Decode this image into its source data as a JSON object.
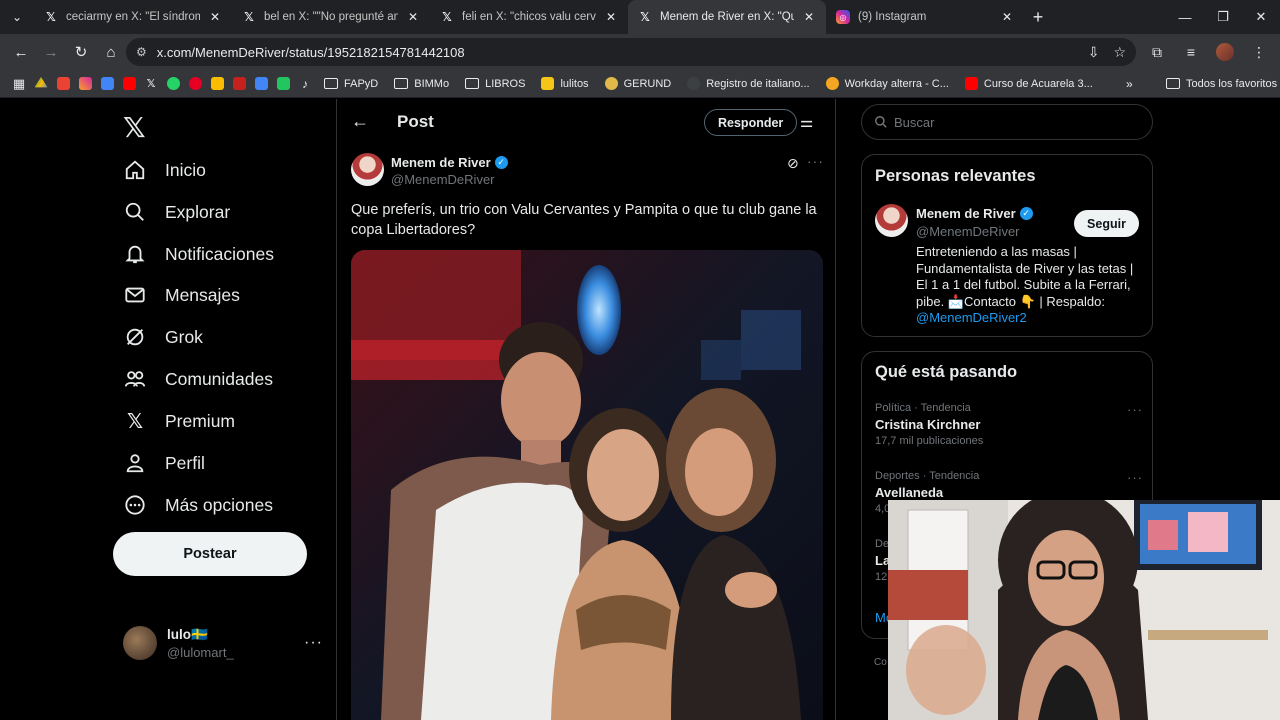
{
  "browser": {
    "tabs": [
      {
        "title": "ceciarmy en X: \"El síndrome de",
        "icon": "x",
        "active": false
      },
      {
        "title": "bel en X: \"\"No pregunté antes d",
        "icon": "x",
        "active": false
      },
      {
        "title": "feli en X: \"chicos valu cervantes",
        "icon": "x",
        "active": false
      },
      {
        "title": "Menem de River en X: \"Que pref",
        "icon": "x",
        "active": true
      },
      {
        "title": "(9) Instagram",
        "icon": "instagram",
        "active": false
      }
    ],
    "url": "x.com/MenemDeRiver/status/1952182154781442108",
    "bookmarks": [
      "FAPyD",
      "BIMMo",
      "LIBROS",
      "lulitos",
      "GERUND",
      "Registro de italiano...",
      "Workday alterra - C...",
      "Curso de Acuarela 3..."
    ],
    "all_bookmarks": "Todos los favoritos"
  },
  "nav": {
    "items": [
      {
        "label": "Inicio",
        "icon": "home-icon"
      },
      {
        "label": "Explorar",
        "icon": "search-icon"
      },
      {
        "label": "Notificaciones",
        "icon": "bell-icon"
      },
      {
        "label": "Mensajes",
        "icon": "mail-icon"
      },
      {
        "label": "Grok",
        "icon": "grok-icon"
      },
      {
        "label": "Comunidades",
        "icon": "people-icon"
      },
      {
        "label": "Premium",
        "icon": "x-icon"
      },
      {
        "label": "Perfil",
        "icon": "person-icon"
      },
      {
        "label": "Más opciones",
        "icon": "more-circle-icon"
      }
    ],
    "post_button": "Postear",
    "account": {
      "name": "lulo🇸🇪",
      "handle": "@lulomart_"
    }
  },
  "post": {
    "header_title": "Post",
    "reply_button": "Responder",
    "author_name": "Menem de River",
    "author_handle": "@MenemDeRiver",
    "text": "Que preferís, un trio con Valu Cervantes y Pampita o que tu club gane la copa Libertadores?"
  },
  "sidebar": {
    "search_placeholder": "Buscar",
    "relevant_title": "Personas relevantes",
    "relevant": {
      "name": "Menem de River",
      "handle": "@MenemDeRiver",
      "follow": "Seguir",
      "bio": "Entreteniendo a las masas | Fundamentalista de River y las tetas | El 1 a 1 del futbol. Subite a la Ferrari, pibe. 📩Contacto 👇 | Respaldo:",
      "bio_link": "@MenemDeRiver2"
    },
    "trending_title": "Qué está pasando",
    "trends": [
      {
        "meta": "Política · Tendencia",
        "name": "Cristina Kirchner",
        "count": "17,7 mil publicaciones"
      },
      {
        "meta": "Deportes · Tendencia",
        "name": "Avellaneda",
        "count": "4,0"
      },
      {
        "meta": "De",
        "name": "La",
        "count": "12,"
      }
    ],
    "more_link": "Mo",
    "footer_fragment": "Co"
  }
}
